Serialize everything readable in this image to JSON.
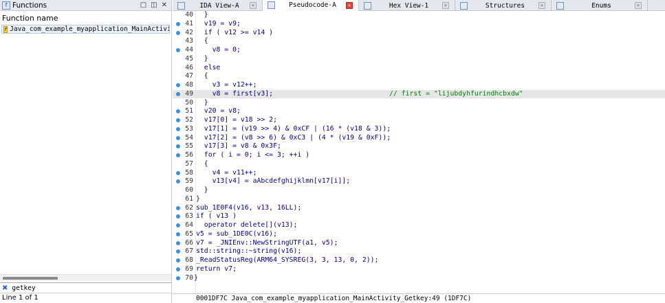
{
  "functions_panel": {
    "title": "Functions",
    "column_header": "Function name",
    "selected_function": "Java_com_example_myapplication_MainActivi⋯",
    "search_text": "getkey",
    "status": "Line 1 of 1"
  },
  "tabs": [
    {
      "label": "IDA View-A",
      "active": false
    },
    {
      "label": "Pseudocode-A",
      "active": true
    },
    {
      "label": "Hex View-1",
      "active": false
    },
    {
      "label": "Structures",
      "active": false
    },
    {
      "label": "Enums",
      "active": false
    }
  ],
  "code_lines": [
    {
      "num": "40",
      "dot": false,
      "text": "  }"
    },
    {
      "num": "41",
      "dot": true,
      "text": "  v19 = v9;"
    },
    {
      "num": "42",
      "dot": true,
      "text": "  if ( v12 >= v14 )"
    },
    {
      "num": "43",
      "dot": false,
      "text": "  {"
    },
    {
      "num": "44",
      "dot": true,
      "text": "    v8 = 0;"
    },
    {
      "num": "45",
      "dot": false,
      "text": "  }"
    },
    {
      "num": "46",
      "dot": false,
      "text": "  else"
    },
    {
      "num": "47",
      "dot": false,
      "text": "  {"
    },
    {
      "num": "48",
      "dot": true,
      "text": "    v3 = v12++;"
    },
    {
      "num": "49",
      "dot": true,
      "text": "    v8 = first[v3];",
      "comment": "// first = \"lijubdyhfurindhcbxdw\"",
      "highlight": true
    },
    {
      "num": "50",
      "dot": false,
      "text": "  }"
    },
    {
      "num": "51",
      "dot": true,
      "text": "  v20 = v8;"
    },
    {
      "num": "52",
      "dot": true,
      "text": "  v17[0] = v18 >> 2;"
    },
    {
      "num": "53",
      "dot": true,
      "text": "  v17[1] = (v19 >> 4) & 0xCF | (16 * (v18 & 3));"
    },
    {
      "num": "54",
      "dot": true,
      "text": "  v17[2] = (v8 >> 6) & 0xC3 | (4 * (v19 & 0xF));"
    },
    {
      "num": "55",
      "dot": true,
      "text": "  v17[3] = v8 & 0x3F;"
    },
    {
      "num": "56",
      "dot": true,
      "text": "  for ( i = 0; i <= 3; ++i )"
    },
    {
      "num": "57",
      "dot": false,
      "text": "  {"
    },
    {
      "num": "58",
      "dot": true,
      "text": "    v4 = v11++;"
    },
    {
      "num": "59",
      "dot": true,
      "text": "    v13[v4] = aAbcdefghijklmn[v17[i]];"
    },
    {
      "num": "60",
      "dot": false,
      "text": "  }"
    },
    {
      "num": "61",
      "dot": false,
      "text": "}"
    },
    {
      "num": "62",
      "dot": true,
      "text": "sub_1E0F4(v16, v13, 16LL);"
    },
    {
      "num": "63",
      "dot": true,
      "text": "if ( v13 )"
    },
    {
      "num": "64",
      "dot": true,
      "text": "  operator delete[](v13);"
    },
    {
      "num": "65",
      "dot": true,
      "text": "v5 = sub_1DE0C(v16);"
    },
    {
      "num": "66",
      "dot": true,
      "text": "v7 = _JNIEnv::NewStringUTF(a1, v5);"
    },
    {
      "num": "67",
      "dot": true,
      "text": "std::string::~string(v16);"
    },
    {
      "num": "68",
      "dot": true,
      "text": "_ReadStatusReg(ARM64_SYSREG(3, 3, 13, 0, 2));"
    },
    {
      "num": "69",
      "dot": true,
      "text": "return v7;"
    },
    {
      "num": "70",
      "dot": true,
      "text": "}",
      "outdent": true
    }
  ],
  "status_bar": "0001DF7C Java_com_example_myapplication_MainActivity_Getkey:49 (1DF7C)"
}
